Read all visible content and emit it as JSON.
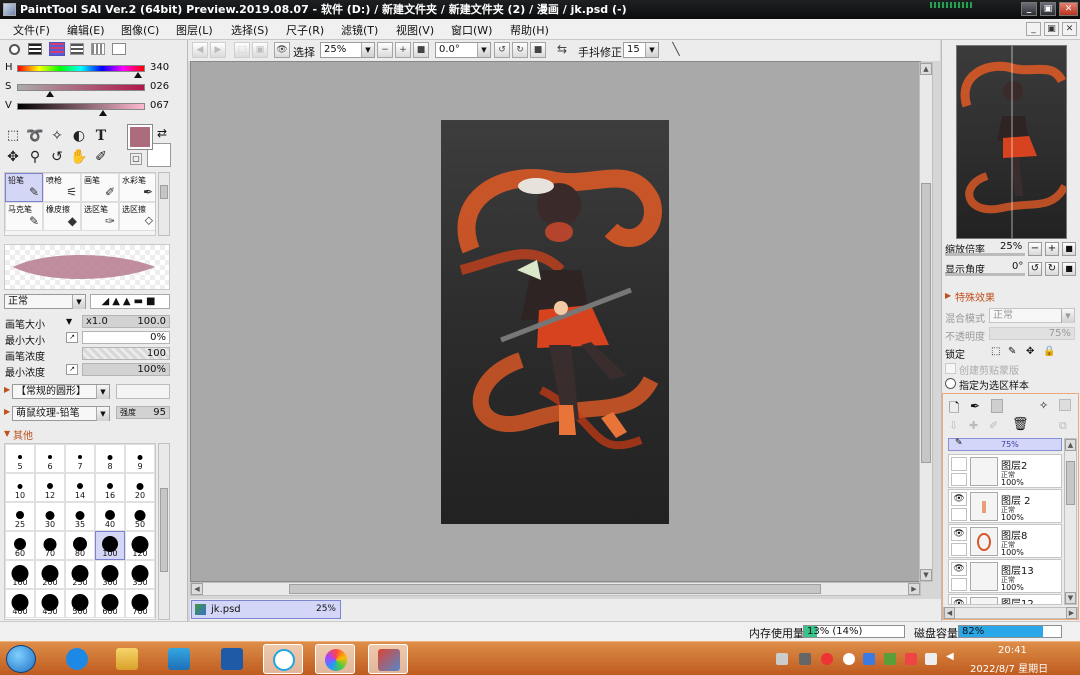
{
  "window": {
    "title": "PaintTool SAI Ver.2 (64bit) Preview.2019.08.07 - 软件 (D:) / 新建文件夹 / 新建文件夹 (2) / 漫画 / jk.psd (-)",
    "minimize": "_",
    "restore": "▣",
    "close": "✕"
  },
  "menu": {
    "items": [
      "文件(F)",
      "编辑(E)",
      "图像(C)",
      "图层(L)",
      "选择(S)",
      "尺子(R)",
      "滤镜(T)",
      "视图(V)",
      "窗口(W)",
      "帮助(H)"
    ],
    "mdi_minimize": "_",
    "mdi_restore": "▣",
    "mdi_close": "✕"
  },
  "toolbar": {
    "select_label": "选择",
    "zoom_value": "25%",
    "zoom_minus": "−",
    "zoom_plus": "+",
    "zoom_reset": "■",
    "angle_value": "0.0°",
    "rotate_ccw": "↺",
    "rotate_cw": "↻",
    "rotate_reset": "■",
    "flip_icon": "⇆",
    "stabilizer_label": "手抖修正",
    "stabilizer_value": "15"
  },
  "color": {
    "h_label": "H",
    "h_value": "340",
    "s_label": "S",
    "s_value": "026",
    "v_label": "V",
    "v_value": "067",
    "h_level": 0.944,
    "s_level": 0.26,
    "v_level": 0.67,
    "primary": "#ad6b7e",
    "secondary": "#ffffff"
  },
  "brushes": [
    {
      "name": "铅笔",
      "glyph": "✎"
    },
    {
      "name": "喷枪",
      "glyph": "⚟"
    },
    {
      "name": "画笔",
      "glyph": "✐"
    },
    {
      "name": "水彩笔",
      "glyph": "✒"
    },
    {
      "name": "马克笔",
      "glyph": "✎"
    },
    {
      "name": "橡皮擦",
      "glyph": "◆"
    },
    {
      "name": "选区笔",
      "glyph": "✑"
    },
    {
      "name": "选区擦",
      "glyph": "⬦"
    }
  ],
  "brush_panel": {
    "blend_mode": "正常",
    "size_label": "画笔大小",
    "size_mult": "x1.0",
    "size_value": "100.0",
    "min_size_label": "最小大小",
    "min_size_value": "0%",
    "density_label": "画笔浓度",
    "density_value": "100",
    "min_density_label": "最小浓度",
    "min_density_value": "100%",
    "shape_label": "【常规的圆形】",
    "texture_label": "萌鼠纹理-铅笔",
    "texture_strength_label": "强度",
    "texture_strength_value": "95",
    "other_label": "其他"
  },
  "brush_sizes": [
    "5",
    "6",
    "7",
    "8",
    "9",
    "10",
    "12",
    "14",
    "16",
    "20",
    "25",
    "30",
    "35",
    "40",
    "50",
    "60",
    "70",
    "80",
    "100",
    "120",
    "160",
    "200",
    "250",
    "300",
    "350",
    "400",
    "450",
    "500",
    "600",
    "700"
  ],
  "document": {
    "tab_name": "jk.psd",
    "tab_zoom": "25%"
  },
  "status": {
    "memory_label": "内存使用量",
    "memory_value": "13% (14%)",
    "memory_level": 0.13,
    "disk_label": "磁盘容量",
    "disk_value": "82%",
    "disk_level": 0.82
  },
  "navigator": {
    "zoom_label": "缩放倍率",
    "zoom_value": "25%",
    "angle_label": "显示角度",
    "angle_value": "0°"
  },
  "effects": {
    "title": "特殊效果",
    "blend_label": "混合模式",
    "blend_value": "正常",
    "opacity_label": "不透明度",
    "opacity_value": "75%",
    "lock_label": "锁定",
    "clip_label": "创建剪贴蒙版",
    "sample_label": "指定为选区样本"
  },
  "layers": [
    {
      "name": "",
      "mode": "",
      "opacity": "75%",
      "visible": false,
      "selected": true
    },
    {
      "name": "图层2",
      "mode": "正常",
      "opacity": "100%",
      "visible": false
    },
    {
      "name": "图层 2",
      "mode": "正常",
      "opacity": "100%",
      "visible": true
    },
    {
      "name": "图层8",
      "mode": "正常",
      "opacity": "100%",
      "visible": true
    },
    {
      "name": "图层13",
      "mode": "正常",
      "opacity": "100%",
      "visible": true
    },
    {
      "name": "图层12",
      "mode": "",
      "opacity": "",
      "visible": true
    }
  ],
  "taskbar": {
    "time": "20:41",
    "date": "2022/8/7 星期日"
  }
}
